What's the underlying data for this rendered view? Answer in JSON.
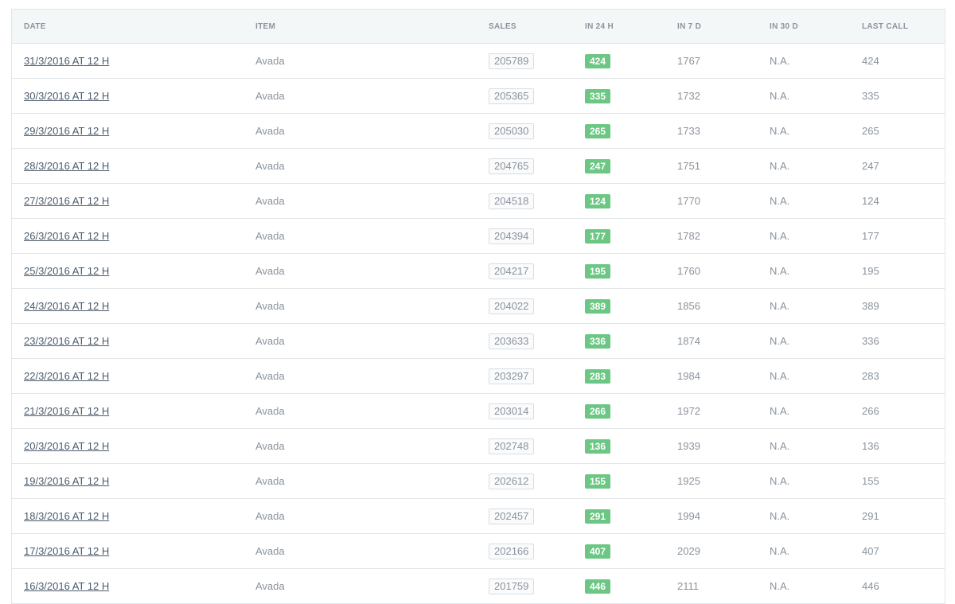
{
  "table": {
    "headers": {
      "date": "DATE",
      "item": "ITEM",
      "sales": "SALES",
      "in_24h": "IN 24 H",
      "in_7d": "IN 7 D",
      "in_30d": "IN 30 D",
      "last_call": "LAST CALL"
    },
    "rows": [
      {
        "date": "31/3/2016 AT 12 H",
        "item": "Avada",
        "sales": "205789",
        "in_24h": "424",
        "in_7d": "1767",
        "in_30d": "N.A.",
        "last_call": "424"
      },
      {
        "date": "30/3/2016 AT 12 H",
        "item": "Avada",
        "sales": "205365",
        "in_24h": "335",
        "in_7d": "1732",
        "in_30d": "N.A.",
        "last_call": "335"
      },
      {
        "date": "29/3/2016 AT 12 H",
        "item": "Avada",
        "sales": "205030",
        "in_24h": "265",
        "in_7d": "1733",
        "in_30d": "N.A.",
        "last_call": "265"
      },
      {
        "date": "28/3/2016 AT 12 H",
        "item": "Avada",
        "sales": "204765",
        "in_24h": "247",
        "in_7d": "1751",
        "in_30d": "N.A.",
        "last_call": "247"
      },
      {
        "date": "27/3/2016 AT 12 H",
        "item": "Avada",
        "sales": "204518",
        "in_24h": "124",
        "in_7d": "1770",
        "in_30d": "N.A.",
        "last_call": "124"
      },
      {
        "date": "26/3/2016 AT 12 H",
        "item": "Avada",
        "sales": "204394",
        "in_24h": "177",
        "in_7d": "1782",
        "in_30d": "N.A.",
        "last_call": "177"
      },
      {
        "date": "25/3/2016 AT 12 H",
        "item": "Avada",
        "sales": "204217",
        "in_24h": "195",
        "in_7d": "1760",
        "in_30d": "N.A.",
        "last_call": "195"
      },
      {
        "date": "24/3/2016 AT 12 H",
        "item": "Avada",
        "sales": "204022",
        "in_24h": "389",
        "in_7d": "1856",
        "in_30d": "N.A.",
        "last_call": "389"
      },
      {
        "date": "23/3/2016 AT 12 H",
        "item": "Avada",
        "sales": "203633",
        "in_24h": "336",
        "in_7d": "1874",
        "in_30d": "N.A.",
        "last_call": "336"
      },
      {
        "date": "22/3/2016 AT 12 H",
        "item": "Avada",
        "sales": "203297",
        "in_24h": "283",
        "in_7d": "1984",
        "in_30d": "N.A.",
        "last_call": "283"
      },
      {
        "date": "21/3/2016 AT 12 H",
        "item": "Avada",
        "sales": "203014",
        "in_24h": "266",
        "in_7d": "1972",
        "in_30d": "N.A.",
        "last_call": "266"
      },
      {
        "date": "20/3/2016 AT 12 H",
        "item": "Avada",
        "sales": "202748",
        "in_24h": "136",
        "in_7d": "1939",
        "in_30d": "N.A.",
        "last_call": "136"
      },
      {
        "date": "19/3/2016 AT 12 H",
        "item": "Avada",
        "sales": "202612",
        "in_24h": "155",
        "in_7d": "1925",
        "in_30d": "N.A.",
        "last_call": "155"
      },
      {
        "date": "18/3/2016 AT 12 H",
        "item": "Avada",
        "sales": "202457",
        "in_24h": "291",
        "in_7d": "1994",
        "in_30d": "N.A.",
        "last_call": "291"
      },
      {
        "date": "17/3/2016 AT 12 H",
        "item": "Avada",
        "sales": "202166",
        "in_24h": "407",
        "in_7d": "2029",
        "in_30d": "N.A.",
        "last_call": "407"
      },
      {
        "date": "16/3/2016 AT 12 H",
        "item": "Avada",
        "sales": "201759",
        "in_24h": "446",
        "in_7d": "2111",
        "in_30d": "N.A.",
        "last_call": "446"
      }
    ]
  },
  "colors": {
    "badge_green": "#6cc785",
    "header_bg": "#f4f7f8",
    "border": "#e2e6e9",
    "link_text": "#4b5b6b"
  }
}
